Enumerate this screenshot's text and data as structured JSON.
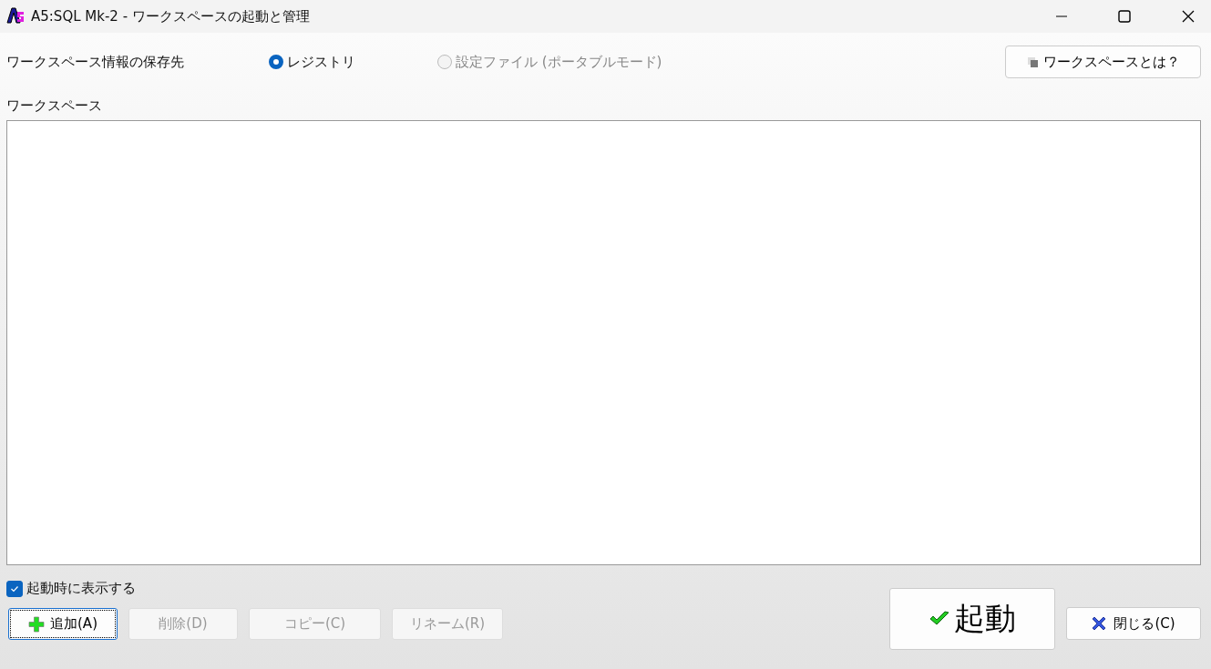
{
  "window": {
    "title": "A5:SQL Mk-2 - ワークスペースの起動と管理"
  },
  "storage": {
    "label": "ワークスペース情報の保存先",
    "options": [
      {
        "label": "レジストリ",
        "selected": true,
        "disabled": false
      },
      {
        "label": "設定ファイル (ポータブルモード)",
        "selected": false,
        "disabled": true
      }
    ],
    "help_button": "ワークスペースとは？"
  },
  "workspace_list": {
    "label": "ワークスペース"
  },
  "show_on_startup": {
    "label": "起動時に表示する",
    "checked": true
  },
  "buttons": [
    {
      "label": "追加(A)",
      "kind": "add",
      "disabled": false,
      "focused": true
    },
    {
      "label": "削除(D)",
      "kind": "plain",
      "disabled": true,
      "focused": false
    },
    {
      "label": "コピー(C)",
      "kind": "plain",
      "disabled": true,
      "focused": false
    },
    {
      "label": "リネーム(R)",
      "kind": "plain",
      "disabled": true,
      "focused": false
    }
  ],
  "start_button": "起動",
  "close_button": "閉じる(C)"
}
